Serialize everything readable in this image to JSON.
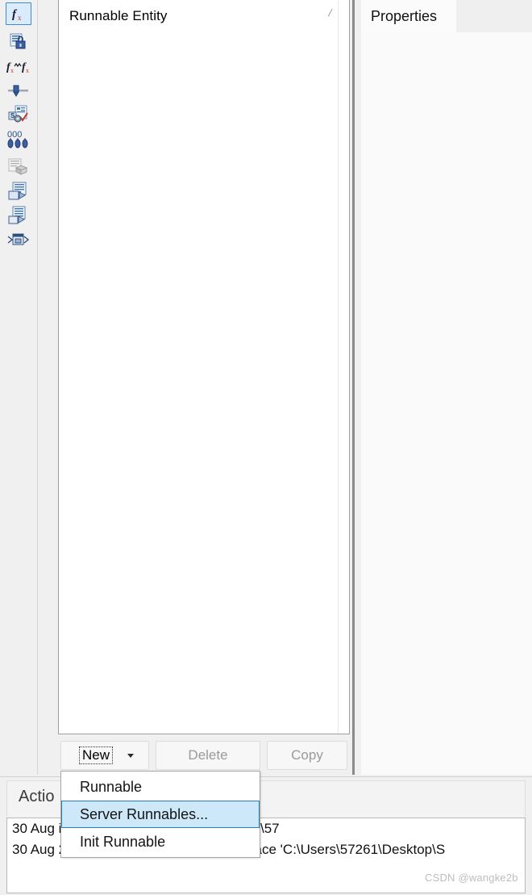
{
  "colors": {
    "accent": "#2b7cc4",
    "menu_highlight_bg": "#cde8f9",
    "panel_bg": "#f0f0f0",
    "disabled_text": "#9a9a9a"
  },
  "left_toolbar": {
    "items": [
      {
        "icon": "function-fx-icon",
        "selected": true
      },
      {
        "icon": "document-lock-icon",
        "selected": false
      },
      {
        "icon": "function-mapping-fx-icon",
        "selected": false
      },
      {
        "icon": "slider-parameter-icon",
        "selected": false
      },
      {
        "icon": "server-document-check-icon",
        "selected": false
      },
      {
        "icon": "three-counters-icon",
        "selected": false
      },
      {
        "icon": "document-package-icon",
        "selected": false
      },
      {
        "icon": "document-export-icon",
        "selected": false
      },
      {
        "icon": "document-list-export-icon",
        "selected": false
      },
      {
        "icon": "interface-connector-icon",
        "selected": false
      }
    ]
  },
  "list_panel": {
    "header": "Runnable Entity",
    "corner_mark": "∕",
    "rows": []
  },
  "buttons": {
    "new_label": "New",
    "delete_label": "Delete",
    "copy_label": "Copy"
  },
  "new_menu": {
    "items": [
      {
        "label": "Runnable",
        "highlighted": false
      },
      {
        "label": "Server Runnables...",
        "highlighted": true
      },
      {
        "label": "Init Runnable",
        "highlighted": false
      }
    ]
  },
  "properties": {
    "tab_label": "Properties"
  },
  "log": {
    "tab_label": "Actio",
    "lines": [
      "30 Aug                                      ile PortInterfaces.arxml (C:\\Users\\57",
      "30 Aug 2022 09:35:09 - Opened workspace 'C:\\Users\\57261\\Desktop\\S"
    ]
  },
  "watermark": "CSDN @wangke2b"
}
